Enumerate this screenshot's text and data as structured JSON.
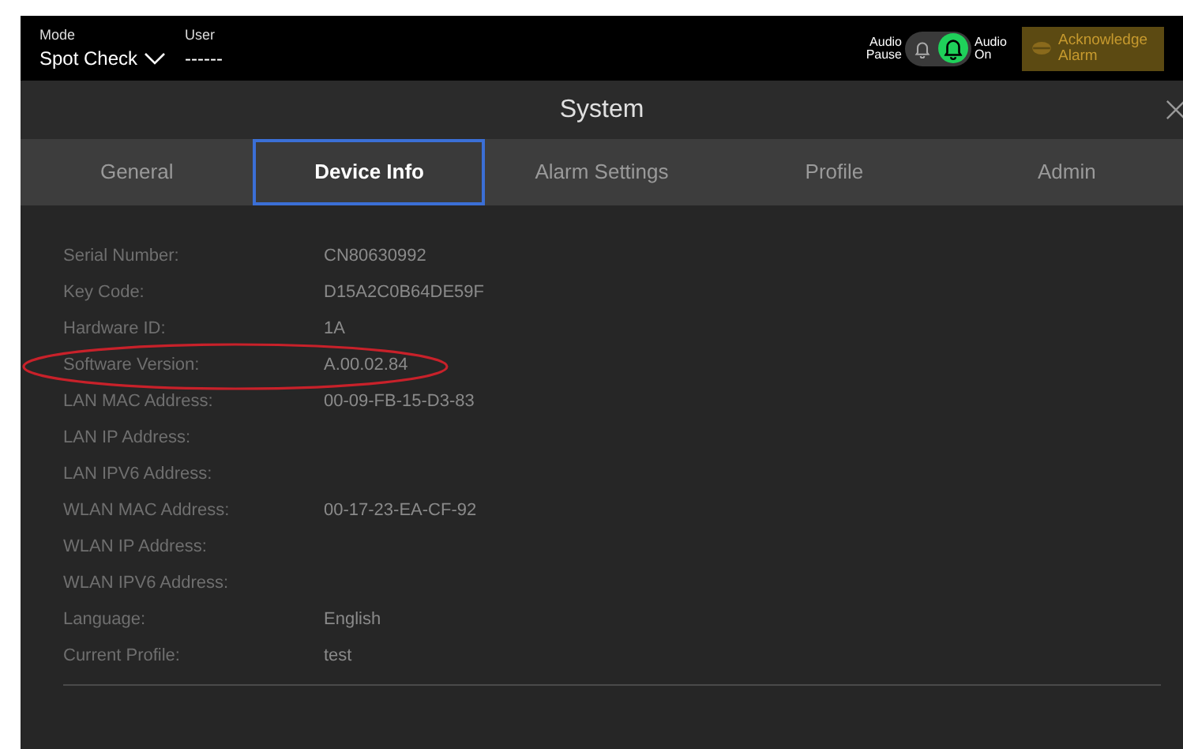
{
  "header": {
    "mode_label": "Mode",
    "mode_value": "Spot Check",
    "user_label": "User",
    "user_value": "------",
    "audio_pause_label": "Audio Pause",
    "audio_on_label": "Audio On",
    "audio_on": true,
    "acknowledge_button": "Acknowledge Alarm"
  },
  "window": {
    "title": "System"
  },
  "tabs": [
    {
      "label": "General",
      "selected": false
    },
    {
      "label": "Device Info",
      "selected": true
    },
    {
      "label": "Alarm Settings",
      "selected": false
    },
    {
      "label": "Profile",
      "selected": false
    },
    {
      "label": "Admin",
      "selected": false
    }
  ],
  "rows": [
    {
      "label": "Serial Number:",
      "value": "CN80630992",
      "circled": false
    },
    {
      "label": "Key Code:",
      "value": "D15A2C0B64DE59F",
      "circled": false
    },
    {
      "label": "Hardware ID:",
      "value": "1A",
      "circled": false
    },
    {
      "label": "Software Version:",
      "value": "A.00.02.84",
      "circled": true
    },
    {
      "label": "LAN MAC Address:",
      "value": "00-09-FB-15-D3-83",
      "circled": false
    },
    {
      "label": "LAN IP Address:",
      "circled": false
    },
    {
      "label": "LAN IPV6 Address:",
      "circled": false
    },
    {
      "label": "WLAN MAC Address:",
      "value": "00-17-23-EA-CF-92",
      "circled": false
    },
    {
      "label": "WLAN IP Address:",
      "circled": false
    },
    {
      "label": "WLAN IPV6 Address:",
      "circled": false
    },
    {
      "label": "Language:",
      "value": "English",
      "circled": false
    },
    {
      "label": "Current Profile:",
      "value": "test",
      "circled": false
    }
  ]
}
